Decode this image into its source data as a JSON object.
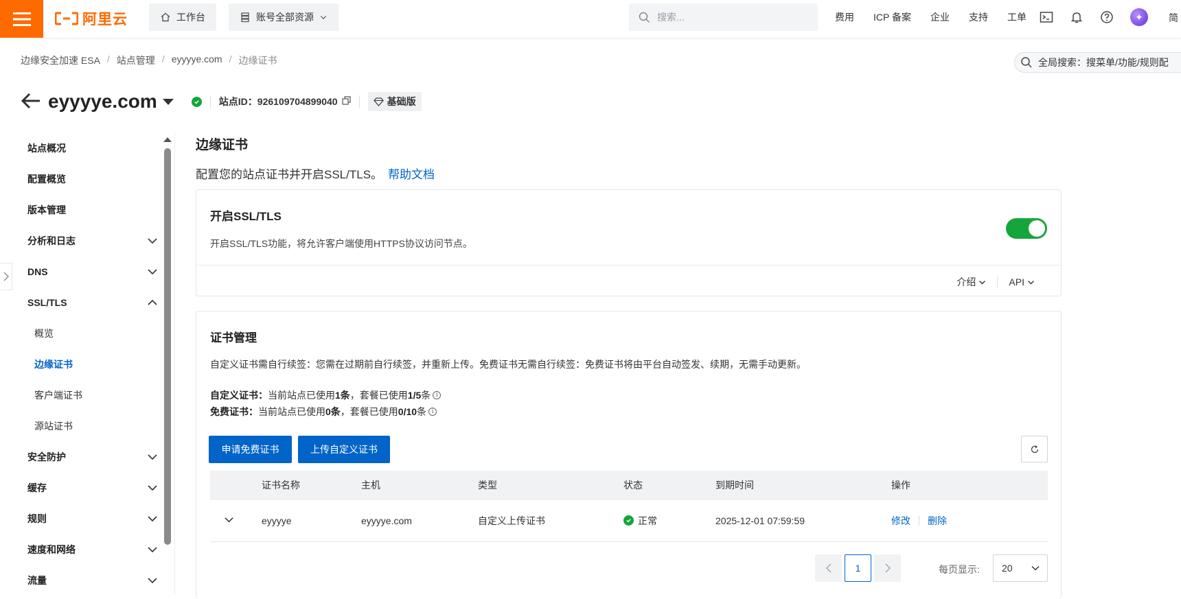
{
  "topbar": {
    "logo_text": "阿里云",
    "workbench_label": "工作台",
    "resources_label": "账号全部资源",
    "search_placeholder": "搜索...",
    "links": [
      "费用",
      "ICP 备案",
      "企业",
      "支持",
      "工单"
    ],
    "lang": "简"
  },
  "breadcrumb": {
    "items": [
      "边缘安全加速 ESA",
      "站点管理",
      "eyyyye.com"
    ],
    "current": "边缘证书"
  },
  "global_search": {
    "label": "全局搜索：搜菜单/功能/规则配"
  },
  "site": {
    "name": "eyyyye.com",
    "id_label": "站点ID：926109704899040",
    "plan": "基础版"
  },
  "sidebar": {
    "items": [
      {
        "label": "站点概况"
      },
      {
        "label": "配置概览"
      },
      {
        "label": "版本管理"
      },
      {
        "label": "分析和日志"
      },
      {
        "label": "DNS"
      },
      {
        "label": "SSL/TLS"
      },
      {
        "label": "概览"
      },
      {
        "label": "边缘证书"
      },
      {
        "label": "客户端证书"
      },
      {
        "label": "源站证书"
      },
      {
        "label": "安全防护"
      },
      {
        "label": "缓存"
      },
      {
        "label": "规则"
      },
      {
        "label": "速度和网络"
      },
      {
        "label": "流量"
      }
    ]
  },
  "main": {
    "title": "边缘证书",
    "desc": "配置您的站点证书并开启SSL/TLS。",
    "help_link": "帮助文档"
  },
  "ssl_card": {
    "title": "开启SSL/TLS",
    "desc": "开启SSL/TLS功能，将允许客户端使用HTTPS协议访问节点。",
    "enabled": true,
    "intro_label": "介绍",
    "api_label": "API"
  },
  "cert_card": {
    "title": "证书管理",
    "note": "自定义证书需自行续签：您需在过期前自行续签，并重新上传。免费证书无需自行续签：免费证书将由平台自动签发、续期，无需手动更新。",
    "custom_label": "自定义证书：",
    "custom_text_a": "当前站点已使用",
    "custom_used": "1条",
    "custom_text_b": "，套餐已使用",
    "custom_quota": "1/5",
    "custom_text_c": "条",
    "free_label": "免费证书：",
    "free_text_a": "当前站点已使用",
    "free_used": "0条",
    "free_text_b": "，套餐已使用",
    "free_quota": "0/10",
    "free_text_c": "条",
    "apply_free_btn": "申请免费证书",
    "upload_btn": "上传自定义证书",
    "columns": [
      "证书名称",
      "主机",
      "类型",
      "状态",
      "到期时间",
      "操作"
    ],
    "rows": [
      {
        "name": "eyyyye",
        "host": "eyyyye.com",
        "type": "自定义上传证书",
        "status": "正常",
        "expires": "2025-12-01 07:59:59",
        "edit": "修改",
        "delete": "删除"
      }
    ]
  },
  "pagination": {
    "current_page": "1",
    "per_page_label": "每页显示:",
    "per_page_value": "20"
  },
  "colors": {
    "accent": "#0064c8",
    "brand": "#ff6a00",
    "success": "#15a63b"
  }
}
